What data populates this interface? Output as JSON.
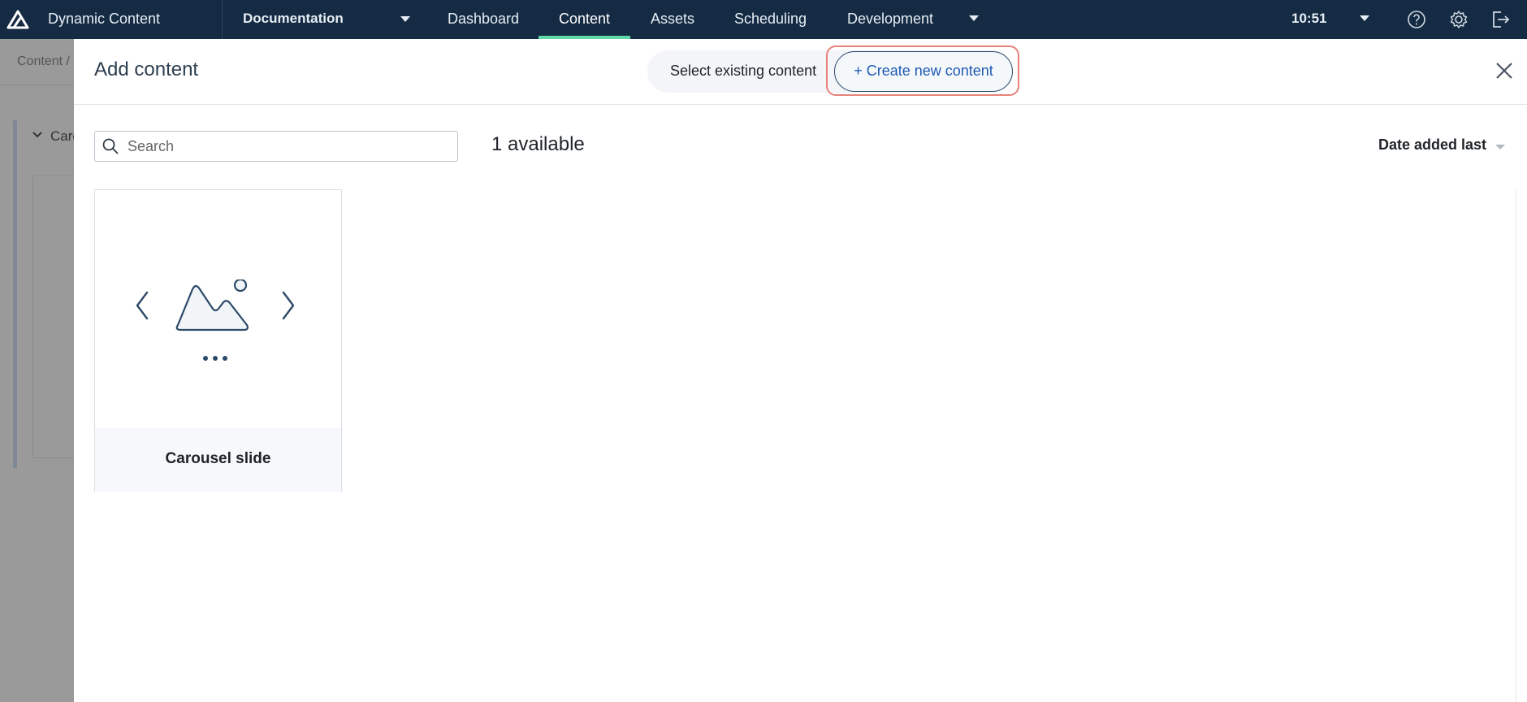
{
  "topbar": {
    "app_name": "Dynamic Content",
    "hub": "Documentation",
    "nav": [
      "Dashboard",
      "Content",
      "Assets",
      "Scheduling",
      "Development"
    ],
    "active_nav": "Content",
    "clock": "10:51",
    "icons": [
      "logo-icon",
      "help-icon",
      "gear-icon",
      "logout-icon"
    ],
    "accent_color": "#5fd7a9",
    "bar_color": "#152b43"
  },
  "background": {
    "breadcrumb": "Content /",
    "section_label": "Caro"
  },
  "modal": {
    "title": "Add content",
    "tab_existing": "Select existing content",
    "tab_create": "+ Create new content",
    "search": {
      "value": "",
      "placeholder": "Search"
    },
    "available": "1 available",
    "sort_label": "Date added last",
    "items": [
      {
        "label": "Carousel slide",
        "icon": "carousel-icon"
      }
    ],
    "highlight_color": "#e7827b",
    "link_color": "#1e5ab4"
  }
}
